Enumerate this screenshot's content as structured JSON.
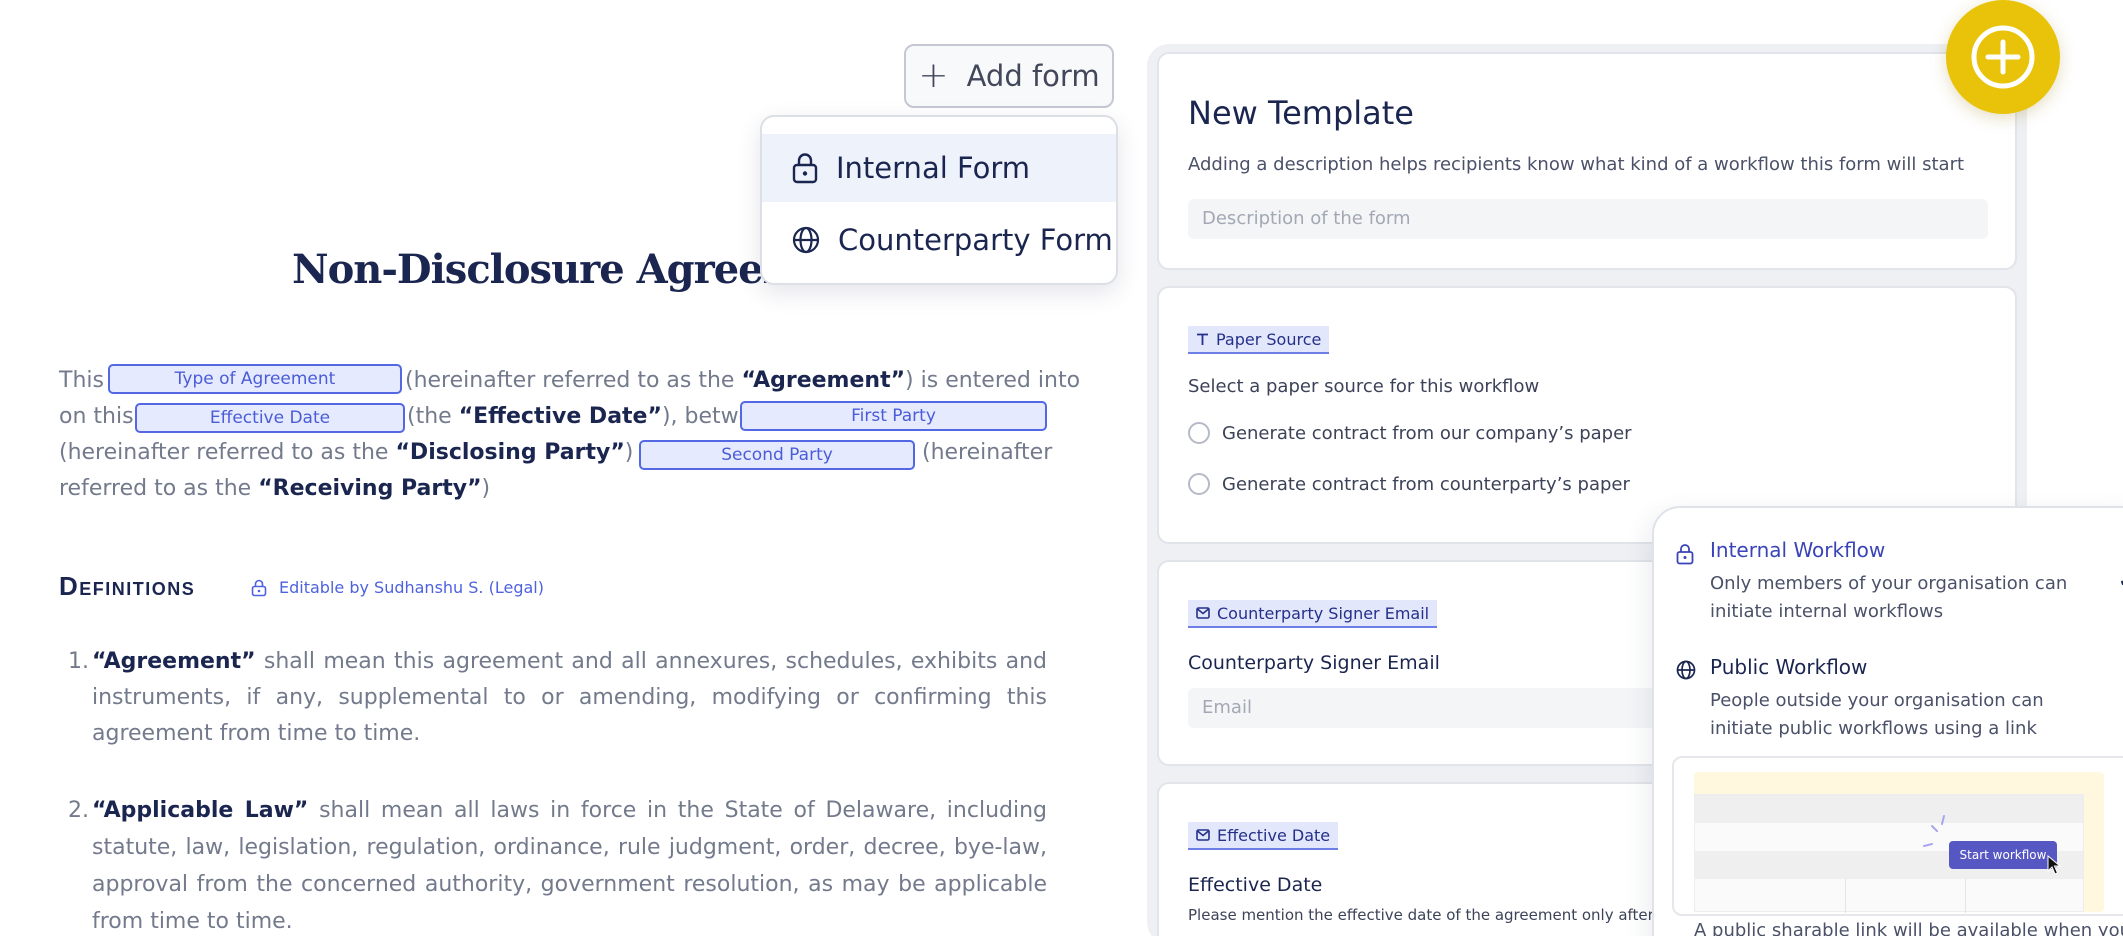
{
  "document": {
    "title": "Non-Disclosure Agreement",
    "intro": {
      "this": "This",
      "chip_type": "Type of Agreement",
      "hereinafter_1": "(hereinafter referred to as the ",
      "agreement_bold": "“Agreement”",
      "entered_into": ") is entered into",
      "on_this": "on this",
      "chip_date": "Effective Date",
      "the_open": "(the ",
      "effective_bold": "“Effective Date”",
      "between": "), between",
      "chip_first": "First Party",
      "hereinafter_2": "(hereinafter referred to as the ",
      "disclosing_bold": "“Disclosing Party”",
      "and": ") and",
      "chip_second": "Second Party",
      "hereinafter_3": "(hereinafter",
      "referred_to": "referred to as the ",
      "receiving_bold": "“Receiving Party”",
      "close": ")"
    },
    "definitions": {
      "heading": "Definitions",
      "editable_note": "Editable by Sudhanshu S. (Legal)",
      "items": [
        {
          "num": "1.",
          "term": "“Agreement”",
          "text": " shall mean this agreement and all annexures, schedules, exhibits and instruments, if any, supplemental to or amending, modifying or confirming this agreement from time to time."
        },
        {
          "num": "2.",
          "term": "“Applicable Law”",
          "text": " shall mean all laws in force in the State of Delaware, including statute, law, legislation, regulation, ordinance, rule judgment, order, decree, bye-law, approval from the concerned authority, government resolution, as may be applicable from time to time."
        }
      ]
    }
  },
  "add_form": {
    "button_label": "Add form",
    "menu": [
      {
        "label": "Internal Form",
        "icon": "lock-icon"
      },
      {
        "label": "Counterparty Form",
        "icon": "globe-icon"
      }
    ]
  },
  "template": {
    "title": "New Template",
    "description": "Adding a description helps recipients know what kind of a workflow this form will start",
    "description_placeholder": "Description of the form",
    "paper_source": {
      "tag": "Paper Source",
      "prompt": "Select a paper source for this workflow",
      "options": [
        "Generate contract from our company’s paper",
        "Generate contract from counterparty’s paper"
      ]
    },
    "signer_email": {
      "tag": "Counterparty Signer Email",
      "label": "Counterparty Signer Email",
      "placeholder": "Email"
    },
    "effective_date": {
      "tag": "Effective Date",
      "label": "Effective Date",
      "help": "Please mention the effective date of the agreement only after th"
    }
  },
  "workflow_popup": {
    "internal": {
      "title": "Internal Workflow",
      "desc": "Only members of your organisation can initiate internal workflows"
    },
    "public": {
      "title": "Public Workflow",
      "desc": "People outside your organisation can initiate public workflows using a link"
    },
    "preview_button": "Start workflow",
    "footer": "A public sharable link will be available when you"
  },
  "colors": {
    "accent": "#5468e3",
    "fab": "#e8c30a",
    "navy": "#1b2650",
    "internal_title": "#3a44b8"
  }
}
